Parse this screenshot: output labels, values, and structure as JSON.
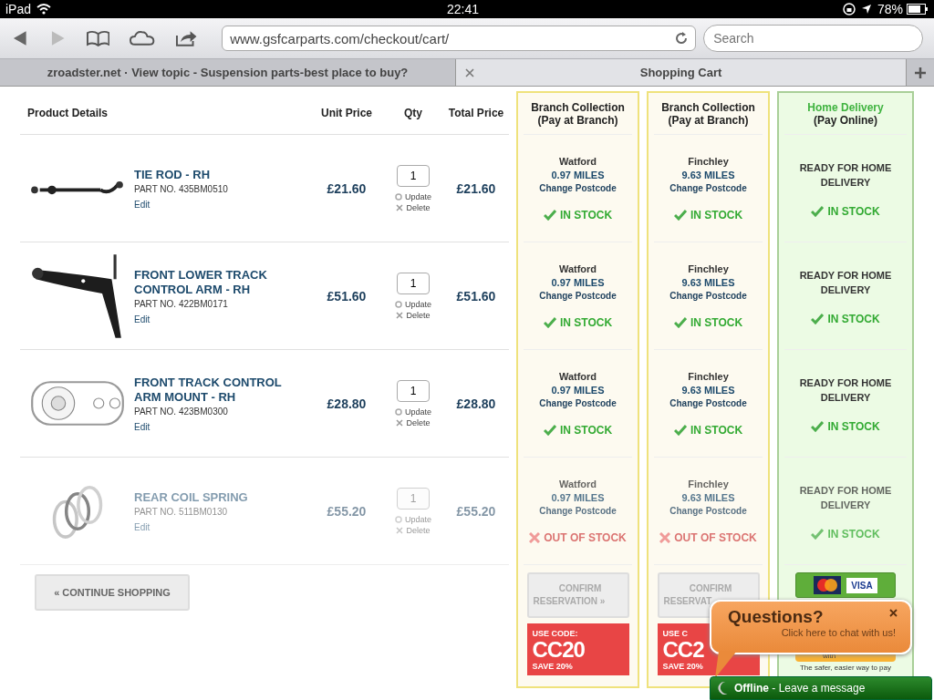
{
  "status_bar": {
    "device": "iPad",
    "time": "22:41",
    "battery": "78%"
  },
  "browser": {
    "url": "www.gsfcarparts.com/checkout/cart/",
    "search_placeholder": "Search",
    "tabs": [
      {
        "label": "zroadster.net · View topic - Suspension parts-best place to buy?",
        "selected": false
      },
      {
        "label": "Shopping Cart",
        "selected": true
      }
    ]
  },
  "cart": {
    "columns": [
      "Product Details",
      "Unit Price",
      "Qty",
      "Total Price"
    ],
    "options": [
      {
        "kind": "branch",
        "title": "Branch Collection",
        "subtitle": "(Pay at Branch)"
      },
      {
        "kind": "branch",
        "title": "Branch Collection",
        "subtitle": "(Pay at Branch)"
      },
      {
        "kind": "home",
        "title": "Home Delivery",
        "subtitle": "(Pay Online)"
      }
    ],
    "items": [
      {
        "name": "TIE ROD - RH",
        "part_no": "PART NO. 435BM0510",
        "edit": "Edit",
        "unit_price": "£21.60",
        "qty": "1",
        "update": "Update",
        "delete": "Delete",
        "total": "£21.60",
        "disabled": false,
        "availability": [
          {
            "kind": "branch",
            "location": "Watford",
            "distance": "0.97 MILES",
            "link": "Change Postcode",
            "status": "IN STOCK",
            "in_stock": true
          },
          {
            "kind": "branch",
            "location": "Finchley",
            "distance": "9.63 MILES",
            "link": "Change Postcode",
            "status": "IN STOCK",
            "in_stock": true
          },
          {
            "kind": "home",
            "message": "READY FOR HOME DELIVERY",
            "status": "IN STOCK",
            "in_stock": true
          }
        ]
      },
      {
        "name": "FRONT LOWER TRACK CONTROL ARM - RH",
        "part_no": "PART NO. 422BM0171",
        "edit": "Edit",
        "unit_price": "£51.60",
        "qty": "1",
        "update": "Update",
        "delete": "Delete",
        "total": "£51.60",
        "disabled": false,
        "availability": [
          {
            "kind": "branch",
            "location": "Watford",
            "distance": "0.97 MILES",
            "link": "Change Postcode",
            "status": "IN STOCK",
            "in_stock": true
          },
          {
            "kind": "branch",
            "location": "Finchley",
            "distance": "9.63 MILES",
            "link": "Change Postcode",
            "status": "IN STOCK",
            "in_stock": true
          },
          {
            "kind": "home",
            "message": "READY FOR HOME DELIVERY",
            "status": "IN STOCK",
            "in_stock": true
          }
        ]
      },
      {
        "name": "FRONT TRACK CONTROL ARM MOUNT - RH",
        "part_no": "PART NO. 423BM0300",
        "edit": "Edit",
        "unit_price": "£28.80",
        "qty": "1",
        "update": "Update",
        "delete": "Delete",
        "total": "£28.80",
        "disabled": false,
        "availability": [
          {
            "kind": "branch",
            "location": "Watford",
            "distance": "0.97 MILES",
            "link": "Change Postcode",
            "status": "IN STOCK",
            "in_stock": true
          },
          {
            "kind": "branch",
            "location": "Finchley",
            "distance": "9.63 MILES",
            "link": "Change Postcode",
            "status": "IN STOCK",
            "in_stock": true
          },
          {
            "kind": "home",
            "message": "READY FOR HOME DELIVERY",
            "status": "IN STOCK",
            "in_stock": true
          }
        ]
      },
      {
        "name": "REAR COIL SPRING",
        "part_no": "PART NO. 511BM0130",
        "edit": "Edit",
        "unit_price": "£55.20",
        "qty": "1",
        "update": "Update",
        "delete": "Delete",
        "total": "£55.20",
        "disabled": true,
        "availability": [
          {
            "kind": "branch",
            "location": "Watford",
            "distance": "0.97 MILES",
            "link": "Change Postcode",
            "status": "OUT OF STOCK",
            "in_stock": false
          },
          {
            "kind": "branch",
            "location": "Finchley",
            "distance": "9.63 MILES",
            "link": "Change Postcode",
            "status": "OUT OF STOCK",
            "in_stock": false
          },
          {
            "kind": "home",
            "message": "READY FOR HOME DELIVERY",
            "status": "IN STOCK",
            "in_stock": true
          }
        ]
      }
    ],
    "continue_shopping": "« CONTINUE SHOPPING",
    "actions": [
      {
        "kind": "reserve",
        "button": [
          "CONFIRM",
          "RESERVATION »"
        ],
        "promo": [
          "USE CODE:",
          "CC20",
          "SAVE 20%"
        ]
      },
      {
        "kind": "reserve",
        "button": [
          "CONFIRM",
          "RESERVAT"
        ],
        "promo": [
          "USE C",
          "CC2",
          "SAVE 20%"
        ]
      },
      {
        "kind": "pay",
        "card": "VISA",
        "paypal": "with",
        "tagline": "The safer, easier way to pay"
      }
    ]
  },
  "chat": {
    "title": "Questions?",
    "subtitle": "Click here to chat with us!",
    "status": "Offline",
    "message": " - Leave a message"
  }
}
